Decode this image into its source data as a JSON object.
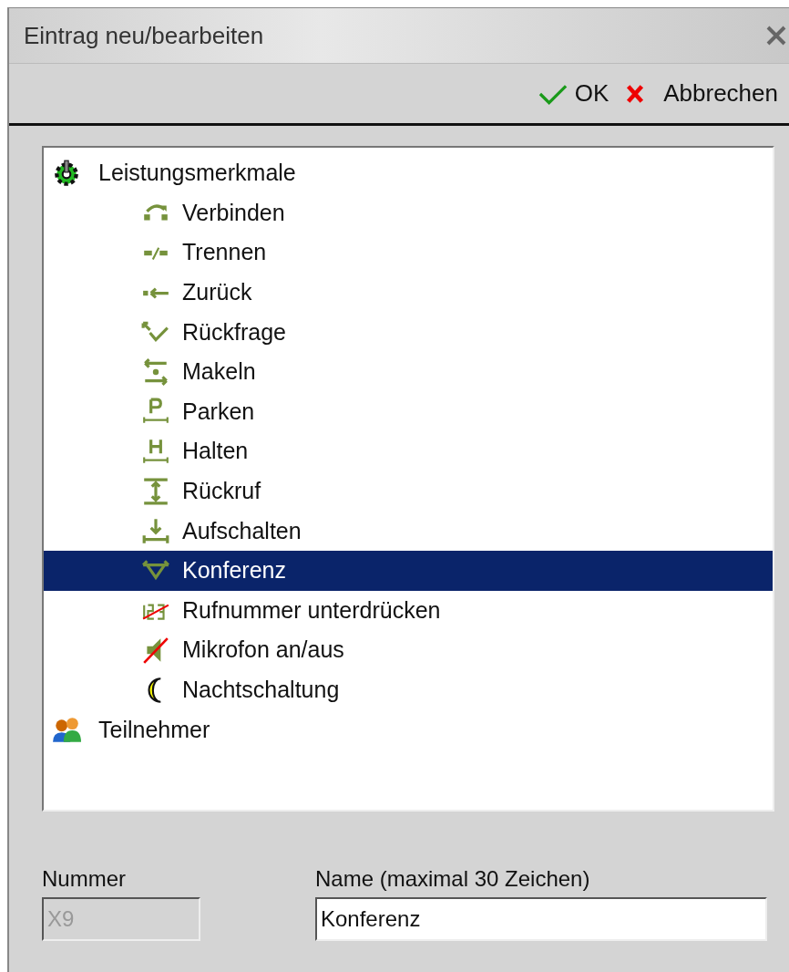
{
  "window": {
    "title": "Eintrag neu/bearbeiten"
  },
  "toolbar": [
    {
      "kind": "ok",
      "label": "OK"
    },
    {
      "kind": "cancel",
      "label": "Abbrechen"
    }
  ],
  "tree": [
    {
      "label": "Leistungsmerkmale",
      "kind": "features",
      "selected": false,
      "children": [
        {
          "label": "Verbinden",
          "kind": "connect",
          "selected": false
        },
        {
          "label": "Trennen",
          "kind": "disconnect",
          "selected": false
        },
        {
          "label": "Zurück",
          "kind": "back",
          "selected": false
        },
        {
          "label": "Rückfrage",
          "kind": "inquiry",
          "selected": false
        },
        {
          "label": "Makeln",
          "kind": "toggle",
          "selected": false
        },
        {
          "label": "Parken",
          "kind": "park",
          "selected": false
        },
        {
          "label": "Halten",
          "kind": "hold",
          "selected": false
        },
        {
          "label": "Rückruf",
          "kind": "callback",
          "selected": false
        },
        {
          "label": "Aufschalten",
          "kind": "intrude",
          "selected": false
        },
        {
          "label": "Konferenz",
          "kind": "conference",
          "selected": true
        },
        {
          "label": "Rufnummer unterdrücken",
          "kind": "hide-number",
          "selected": false
        },
        {
          "label": "Mikrofon an/aus",
          "kind": "mute",
          "selected": false
        },
        {
          "label": "Nachtschaltung",
          "kind": "night",
          "selected": false
        }
      ]
    },
    {
      "label": "Teilnehmer",
      "kind": "users",
      "selected": false
    }
  ],
  "fields": [
    {
      "label": "Nummer",
      "value": "X9",
      "disabled": true
    },
    {
      "label": "Name (maximal 30 Zeichen)",
      "value": "Konferenz",
      "disabled": false
    }
  ]
}
